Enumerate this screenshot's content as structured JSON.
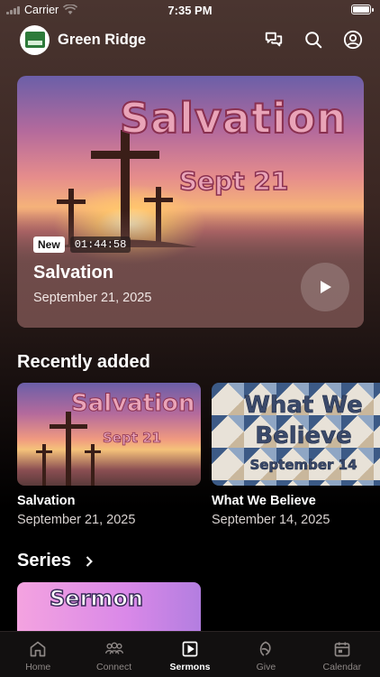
{
  "status_bar": {
    "carrier": "Carrier",
    "time": "7:35 PM"
  },
  "header": {
    "church_name": "Green Ridge",
    "icons": [
      "chat-icon",
      "search-icon",
      "profile-icon"
    ]
  },
  "hero": {
    "artwork_title": "Salvation",
    "artwork_subtitle": "Sept 21",
    "badge_new": "New",
    "duration": "01:44:58",
    "title": "Salvation",
    "date": "September 21, 2025"
  },
  "recently_added": {
    "heading": "Recently added",
    "items": [
      {
        "art_line1": "Salvation",
        "art_line2": "Sept 21",
        "title": "Salvation",
        "date": "September 21, 2025"
      },
      {
        "art_line1": "What We",
        "art_line2": "Believe",
        "art_line3": "September 14",
        "title": "What We Believe",
        "date": "September 14, 2025"
      }
    ]
  },
  "series": {
    "heading": "Series",
    "art_line1": "Sermon"
  },
  "tabs": [
    {
      "label": "Home",
      "icon": "home-icon",
      "active": false
    },
    {
      "label": "Connect",
      "icon": "people-icon",
      "active": false
    },
    {
      "label": "Sermons",
      "icon": "play-square-icon",
      "active": true
    },
    {
      "label": "Give",
      "icon": "give-icon",
      "active": false
    },
    {
      "label": "Calendar",
      "icon": "calendar-icon",
      "active": false
    }
  ]
}
